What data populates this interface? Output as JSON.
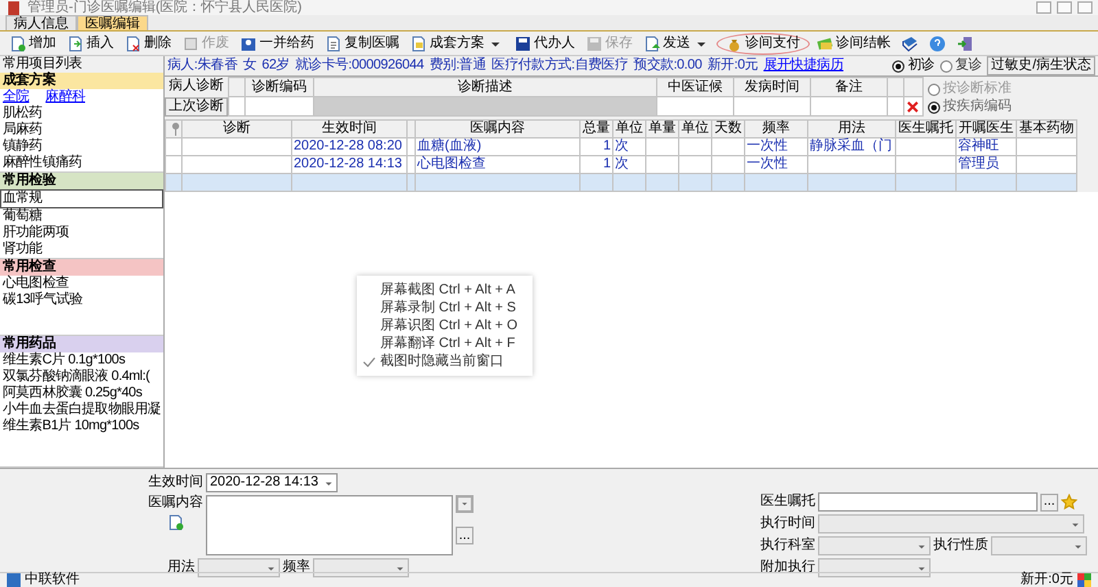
{
  "window": {
    "title": "管理员-门诊医嘱编辑(医院：怀宁县人民医院)"
  },
  "tabs": [
    {
      "label": "病人信息",
      "selected": false
    },
    {
      "label": "医嘱编辑",
      "selected": true
    }
  ],
  "toolbar": [
    {
      "label": "增加",
      "disabled": false,
      "dropdown": false,
      "highlighted": false
    },
    {
      "label": "插入",
      "disabled": false,
      "dropdown": false,
      "highlighted": false
    },
    {
      "label": "删除",
      "disabled": false,
      "dropdown": false,
      "highlighted": false
    },
    {
      "label": "作废",
      "disabled": true,
      "dropdown": false,
      "highlighted": false
    },
    {
      "label": "一并给药",
      "disabled": false,
      "dropdown": false,
      "highlighted": false
    },
    {
      "label": "复制医嘱",
      "disabled": false,
      "dropdown": false,
      "highlighted": false
    },
    {
      "label": "成套方案",
      "disabled": false,
      "dropdown": true,
      "highlighted": false
    },
    {
      "label": "代办人",
      "disabled": false,
      "dropdown": false,
      "highlighted": false
    },
    {
      "label": "保存",
      "disabled": true,
      "dropdown": false,
      "highlighted": false
    },
    {
      "label": "发送",
      "disabled": false,
      "dropdown": true,
      "highlighted": false
    },
    {
      "label": "诊间支付",
      "disabled": false,
      "dropdown": false,
      "highlighted": true
    },
    {
      "label": "诊间结帐",
      "disabled": false,
      "dropdown": false,
      "highlighted": false
    }
  ],
  "sidebar": {
    "title": "常用项目列表",
    "sections": [
      {
        "title": "成套方案",
        "color": "#fbe6a0",
        "links": [
          "全院",
          "麻醉科"
        ],
        "items": [
          {
            "label": "肌松药",
            "selected": false
          },
          {
            "label": "局麻药",
            "selected": false
          },
          {
            "label": "镇静药",
            "selected": false
          },
          {
            "label": "麻醉性镇痛药",
            "selected": false
          }
        ]
      },
      {
        "title": "常用检验",
        "color": "#d6e4c4",
        "items": [
          {
            "label": "血常规",
            "selected": true
          },
          {
            "label": "葡萄糖",
            "selected": false
          },
          {
            "label": "肝功能两项",
            "selected": false
          },
          {
            "label": "肾功能",
            "selected": false
          }
        ]
      },
      {
        "title": "常用检查",
        "color": "#f5c4c4",
        "items": [
          {
            "label": "心电图检查",
            "selected": false
          },
          {
            "label": "碳13呼气试验",
            "selected": false
          }
        ]
      },
      {
        "title": "常用药品",
        "color": "#d9d0ee",
        "items": [
          {
            "label": "维生素C片 0.1g*100s",
            "selected": false
          },
          {
            "label": "双氯芬酸钠滴眼液 0.4ml:(",
            "selected": false
          },
          {
            "label": "阿莫西林胶囊 0.25g*40s",
            "selected": false
          },
          {
            "label": "小牛血去蛋白提取物眼用凝",
            "selected": false
          },
          {
            "label": "维生素B1片 10mg*100s",
            "selected": false
          }
        ]
      }
    ]
  },
  "patient": {
    "fields": [
      "病人:朱春香",
      "女",
      "62岁",
      "就诊卡号:0000926044",
      "费别:普通",
      "医疗付款方式:自费医疗",
      "预交款:0.00",
      "新开:0元"
    ],
    "link": "展开快捷病历",
    "visit_types": [
      {
        "label": "初诊",
        "selected": true
      },
      {
        "label": "复诊",
        "selected": false
      }
    ],
    "button": "过敏史/病生状态"
  },
  "diagnosis": {
    "label": "病人诊断",
    "button": "上次诊断",
    "columns": [
      "诊断编码",
      "诊断描述",
      "中医证候",
      "发病时间",
      "备注"
    ],
    "modes": [
      {
        "label": "按诊断标准",
        "selected": false,
        "disabled": true
      },
      {
        "label": "按疾病编码",
        "selected": true,
        "disabled": true
      }
    ]
  },
  "orders": {
    "columns": [
      "诊断",
      "生效时间",
      "",
      "医嘱内容",
      "总量",
      "单位",
      "单量",
      "单位",
      "天数",
      "频率",
      "用法",
      "医生嘱托",
      "开嘱医生",
      "基本药物"
    ],
    "rows": [
      {
        "selected": false,
        "cells": [
          "",
          "2020-12-28 08:20",
          "",
          "血糖(血液)",
          "1",
          "次",
          "",
          "",
          "",
          "一次性",
          "静脉采血（门",
          "",
          "容神旺",
          ""
        ]
      },
      {
        "selected": false,
        "cells": [
          "",
          "2020-12-28 14:13",
          "",
          "心电图检查",
          "1",
          "次",
          "",
          "",
          "",
          "一次性",
          "",
          "",
          "管理员",
          ""
        ]
      },
      {
        "selected": true,
        "cells": [
          "",
          "",
          "",
          "",
          "",
          "",
          "",
          "",
          "",
          "",
          "",
          "",
          "",
          ""
        ]
      }
    ]
  },
  "context_menu": [
    {
      "label": "屏幕截图 Ctrl + Alt + A",
      "checked": false
    },
    {
      "label": "屏幕录制 Ctrl + Alt + S",
      "checked": false
    },
    {
      "label": "屏幕识图 Ctrl + Alt + O",
      "checked": false
    },
    {
      "label": "屏幕翻译 Ctrl + Alt + F",
      "checked": false
    },
    {
      "label": "截图时隐藏当前窗口",
      "checked": true
    }
  ],
  "form": {
    "effective_time": {
      "label": "生效时间",
      "value": "2020-12-28 14:13"
    },
    "content": {
      "label": "医嘱内容",
      "more_button": "..."
    },
    "usage": {
      "label": "用法"
    },
    "frequency": {
      "label": "频率"
    },
    "doctor_note": {
      "label": "医生嘱托",
      "more_button": "..."
    },
    "exec_time": {
      "label": "执行时间"
    },
    "exec_dept": {
      "label": "执行科室"
    },
    "exec_type": {
      "label": "执行性质"
    },
    "extra_exec": {
      "label": "附加执行"
    }
  },
  "status_bar": {
    "company": "中联软件",
    "new_amount": "新开:0元"
  }
}
